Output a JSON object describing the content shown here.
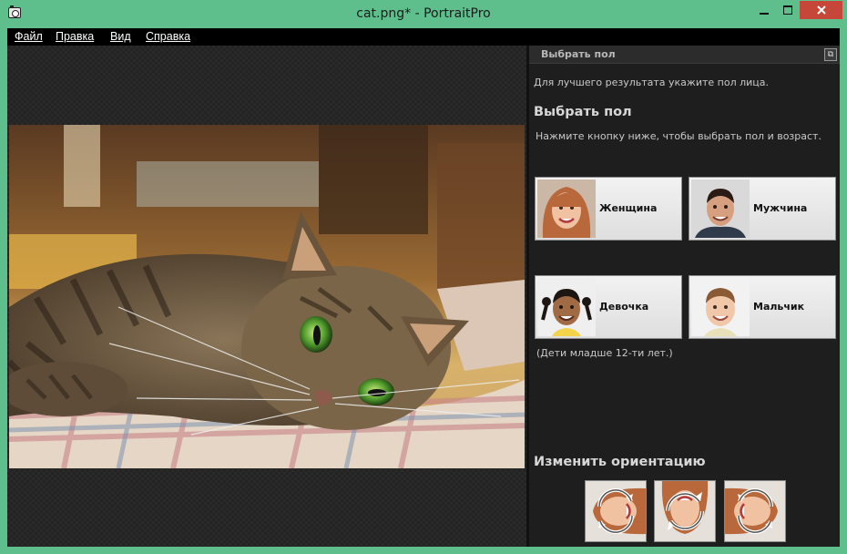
{
  "window": {
    "title": "cat.png* - PortraitPro"
  },
  "icons": {
    "app": "camera-icon",
    "minimize": "minimize-icon",
    "maximize": "maximize-icon",
    "close": "close-icon",
    "panel_restore": "restore-icon",
    "rotate": "rotate-icon"
  },
  "menu": {
    "items": [
      "Файл",
      "Правка",
      "Вид",
      "Справка"
    ]
  },
  "panel": {
    "header": "Выбрать пол",
    "hint": "Для лучшего результата укажите пол лица.",
    "gender_title": "Выбрать пол",
    "gender_desc": "Нажмите кнопку ниже, чтобы выбрать пол и возраст.",
    "buttons": {
      "woman": "Женщина",
      "man": "Мужчина",
      "girl": "Девочка",
      "boy": "Мальчик"
    },
    "children_note": "(Дети младше 12-ти лет.)",
    "orientation_title": "Изменить ориентацию"
  },
  "colors": {
    "frame": "#5fbf8c",
    "close": "#c7463a",
    "panel_bg": "#1e1e1e",
    "menu_bg": "#000000"
  }
}
